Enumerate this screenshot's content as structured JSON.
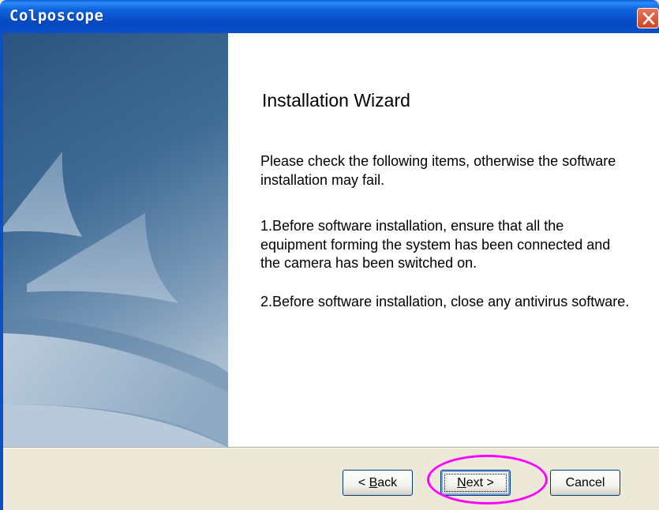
{
  "window": {
    "title": "Colposcope"
  },
  "content": {
    "heading": "Installation Wizard",
    "paragraph_1": "Please check the following items, otherwise the software installation may fail.",
    "paragraph_2": "1.Before software installation, ensure that all the equipment forming the system has been connected and the camera has been switched on.",
    "paragraph_3": "2.Before software installation, close any antivirus software."
  },
  "buttons": {
    "back_prefix": "< ",
    "back_key": "B",
    "back_rest": "ack",
    "next_key": "N",
    "next_rest": "ext >",
    "cancel": "Cancel"
  },
  "colors": {
    "titlebar": "#0548c2",
    "side_panel": "#2c5a86",
    "highlight": "#ff00ff"
  },
  "icons": [
    "close-icon",
    "sail-graphic"
  ]
}
